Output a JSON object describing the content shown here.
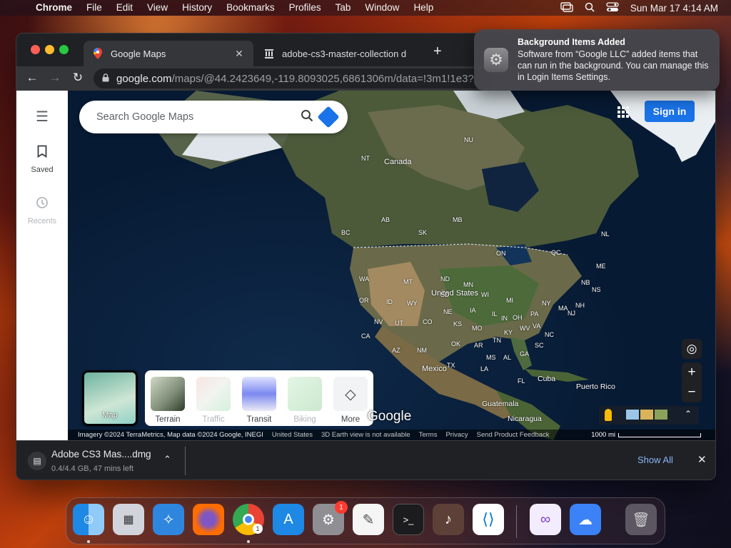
{
  "menubar": {
    "app_name": "Chrome",
    "items": [
      "File",
      "Edit",
      "View",
      "History",
      "Bookmarks",
      "Profiles",
      "Tab",
      "Window",
      "Help"
    ],
    "datetime": "Sun Mar 17  4:14 AM"
  },
  "browser": {
    "tabs": [
      {
        "title": "Google Maps",
        "icon": "google-maps-pin-icon"
      },
      {
        "title": "adobe-cs3-master-collection d",
        "icon": "archive-icon"
      }
    ],
    "url_domain": "google.com",
    "url_path": "/maps/@44.2423649,-119.8093025,6861306m/data=!3m1!1e3?"
  },
  "maps": {
    "rail": {
      "saved_label": "Saved",
      "recents_label": "Recents"
    },
    "search_placeholder": "Search Google Maps",
    "signin_label": "Sign in",
    "layer_current_label": "Map",
    "layers": [
      "Terrain",
      "Traffic",
      "Transit",
      "Biking",
      "More"
    ],
    "watermark": "Google",
    "labels": {
      "canada": "Canada",
      "united_states": "United States",
      "mexico": "Mexico",
      "cuba": "Cuba",
      "puerto_rico": "Puerto Rico",
      "guatemala": "Guatemala",
      "nicaragua": "Nicaragua",
      "provinces": [
        "NU",
        "NT",
        "AB",
        "BC",
        "SK",
        "MB",
        "ON",
        "QC",
        "NL",
        "WA",
        "MT",
        "ND",
        "MN",
        "OR",
        "ID",
        "SD",
        "WI",
        "MI",
        "NY",
        "MA",
        "NB",
        "NS",
        "NV",
        "WY",
        "NE",
        "IA",
        "OH",
        "PA",
        "UT",
        "CO",
        "KS",
        "MO",
        "IL",
        "IN",
        "WV",
        "VA",
        "CA",
        "AZ",
        "NM",
        "OK",
        "AR",
        "KY",
        "TN",
        "NC",
        "SC",
        "TX",
        "MS",
        "AL",
        "GA",
        "LA",
        "FL",
        "ME",
        "NH",
        "NJ"
      ]
    },
    "attribution": "Imagery ©2024 TerraMetrics, Map data ©2024 Google, INEGI",
    "footer_links": [
      "United States",
      "3D Earth view is not available",
      "Terms",
      "Privacy",
      "Send Product Feedback"
    ],
    "scale_label": "1000 mi"
  },
  "download": {
    "filename": "Adobe CS3 Mas....dmg",
    "status": "0.4/4.4 GB, 47 mins left",
    "show_all_label": "Show All"
  },
  "notification": {
    "title": "Background Items Added",
    "body": "Software from “Google LLC” added items that can run in the background. You can manage this in Login Items Settings."
  },
  "dock": {
    "system_settings_badge": "1",
    "chrome_badge": "1"
  }
}
